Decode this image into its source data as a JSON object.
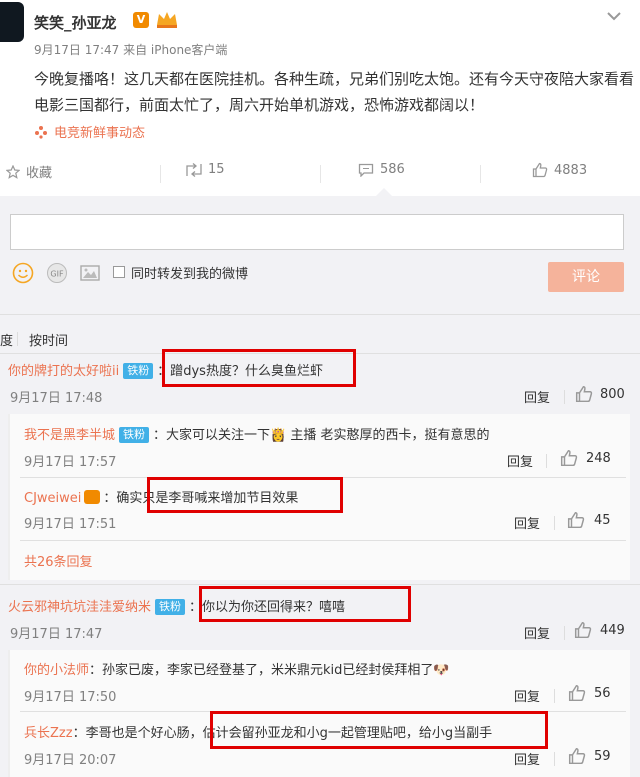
{
  "post": {
    "author": "笑笑_孙亚龙",
    "vip_badge": "V",
    "meta": "9月17日 17:47 来自 iPhone客户端",
    "text": "今晚复播咯！这几天都在医院挂机。各种生疏，兄弟们别吃太饱。还有今天守夜陪大家看看电影三国都行，前面太忙了，周六开始单机游戏，恐怖游戏都阔以！",
    "source_link": "电竞新鲜事动态"
  },
  "actions": {
    "favorite": "收藏",
    "forward_count": "15",
    "comment_count": "586",
    "like_count": "4883"
  },
  "composer": {
    "forward_check_label": "同时转发到我的微博",
    "submit_label": "评论"
  },
  "sort": {
    "partial_label": "度",
    "by_time": "按时间"
  },
  "comments": [
    {
      "user": "你的牌打的太好啦ii",
      "badge": "铁粉",
      "text": "：蹭dys热度？什么臭鱼烂虾",
      "time": "9月17日 17:48",
      "reply": "回复",
      "likes": "800"
    },
    {
      "user": "我不是黑李半城",
      "badge": "铁粉",
      "text": "：大家可以关注一下👸 主播 老实憨厚的西卡，挺有意思的",
      "time": "9月17日 17:57",
      "reply": "回复",
      "likes": "248"
    },
    {
      "user": "CJweiwei",
      "badge": "",
      "text": "：确实只是李哥喊来增加节目效果",
      "time": "9月17日 17:51",
      "reply": "回复",
      "likes": "45"
    },
    {
      "more": "共26条回复"
    },
    {
      "user": "火云邪神坑坑洼洼爱纳米",
      "badge": "铁粉",
      "text": "：你以为你还回得来？嘻嘻",
      "time": "9月17日 17:47",
      "reply": "回复",
      "likes": "449"
    },
    {
      "user": "你的小法师",
      "badge": "",
      "text": "：孙家已废，李家已经登基了，米米鼎元kid已经封侯拜相了🐶",
      "time": "9月17日 17:50",
      "reply": "回复",
      "likes": "56"
    },
    {
      "user": "兵长Zzz",
      "badge": "",
      "text": "：李哥也是个好心肠，估计会留孙亚龙和小g一起管理贴吧，给小g当副手",
      "time": "9月17日 20:07",
      "reply": "回复",
      "likes": "59"
    }
  ],
  "colors": {
    "accent": "#eb7350",
    "highlight_box": "#e00000",
    "badge_blue": "#41b0e7"
  }
}
